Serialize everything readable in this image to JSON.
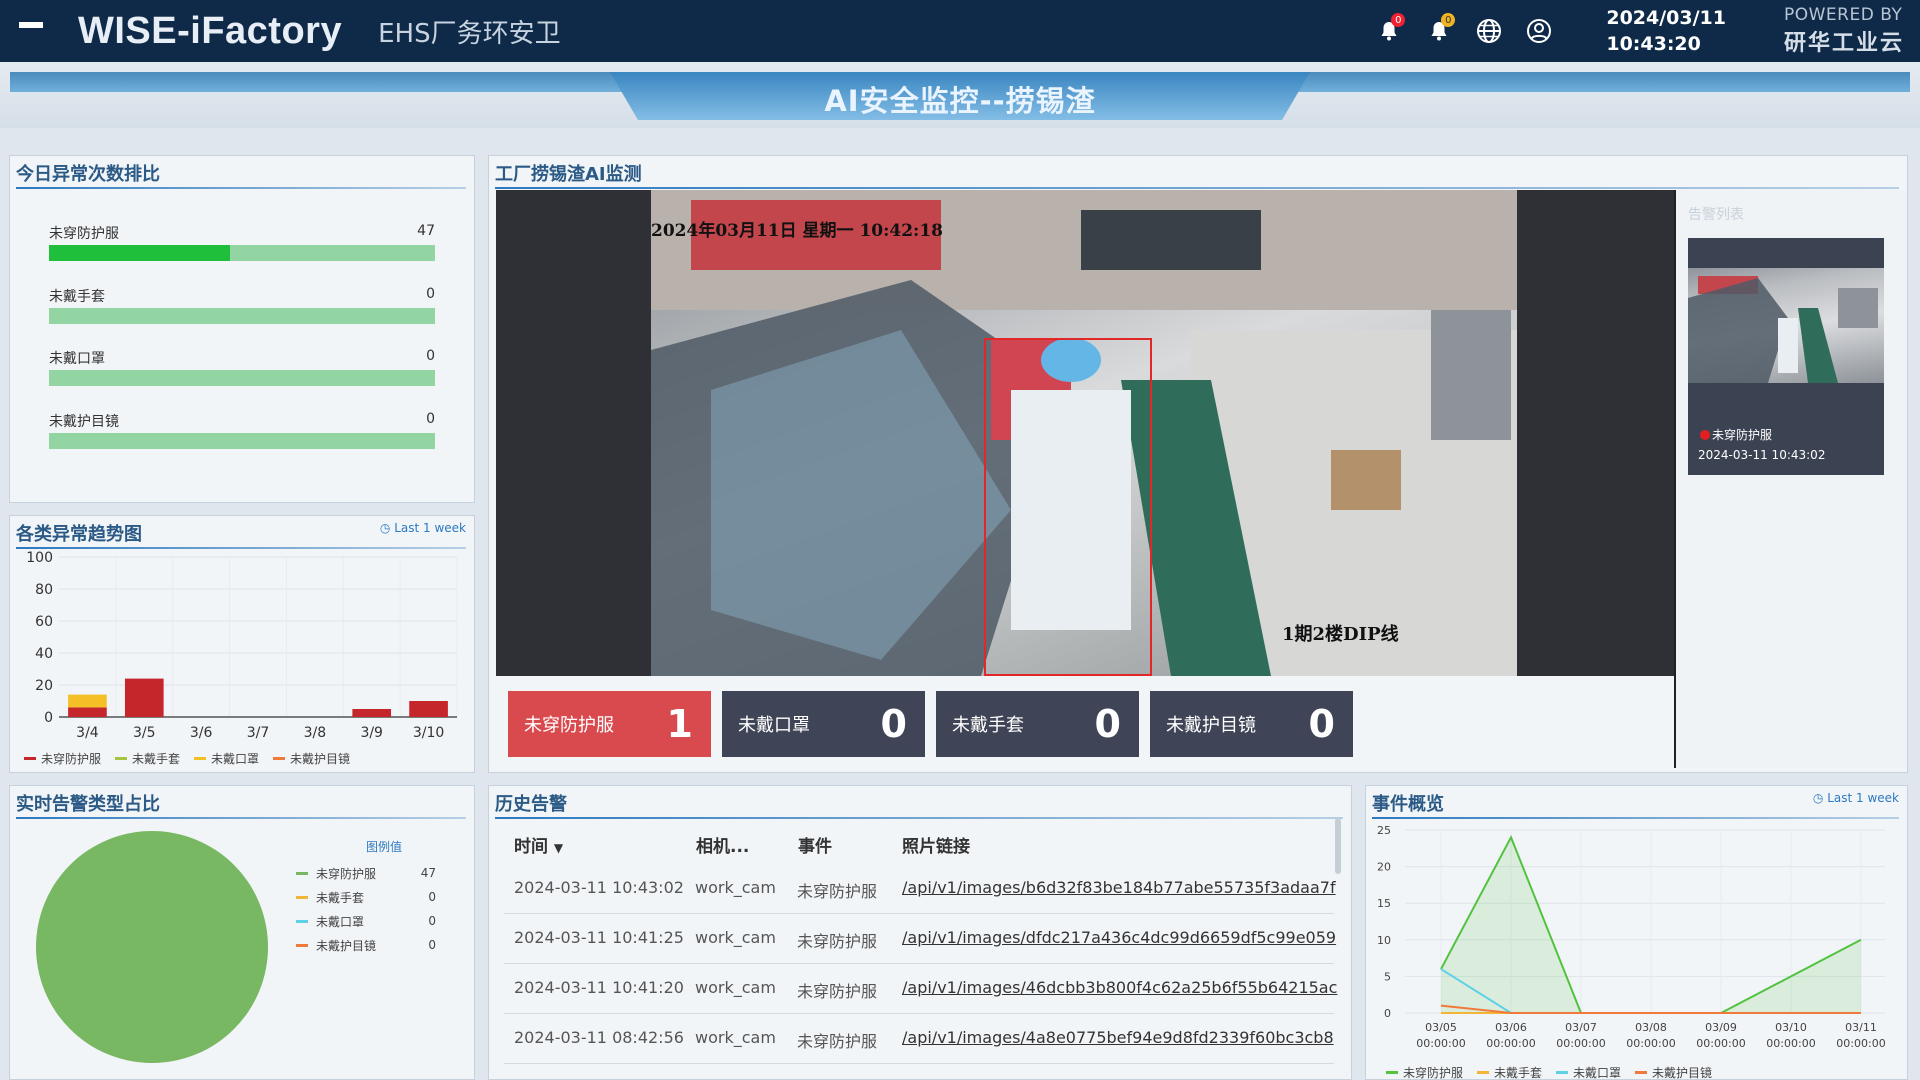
{
  "header": {
    "brand": "WISE-iFactory",
    "module": "EHS厂务环安卫",
    "notif_count_1": "0",
    "notif_count_2": "0",
    "date": "2024/03/11",
    "time": "10:43:20",
    "powered_by": "POWERED BY",
    "vendor": "研华工业云",
    "icons": [
      "menu-icon",
      "bell-icon",
      "bell-icon",
      "globe-icon",
      "user-icon"
    ]
  },
  "page_title": "AI安全监控--捞锡渣",
  "ranking": {
    "title": "今日异常次数排比",
    "max": 47,
    "items": [
      {
        "label": "未穿防护服",
        "value": 47,
        "fill": 0.47
      },
      {
        "label": "未戴手套",
        "value": 0,
        "fill": 0
      },
      {
        "label": "未戴口罩",
        "value": 0,
        "fill": 0
      },
      {
        "label": "未戴护目镜",
        "value": 0,
        "fill": 0
      }
    ]
  },
  "trend": {
    "title": "各类异常趋势图",
    "range": "Last 1 week",
    "legend": [
      "未穿防护服",
      "未戴手套",
      "未戴口罩",
      "未戴护目镜"
    ]
  },
  "monitor": {
    "title": "工厂捞锡渣AI监测",
    "timestamp": "2024年03月11日 星期一 10:42:18",
    "location": "1期2楼DIP线",
    "alert_list_title": "告警列表",
    "alert": {
      "event": "未穿防护服",
      "time": "2024-03-11 10:43:02"
    },
    "stats": [
      {
        "label": "未穿防护服",
        "value": "1",
        "color": "#d94a4f"
      },
      {
        "label": "未戴口罩",
        "value": "0",
        "color": "#3f4556"
      },
      {
        "label": "未戴手套",
        "value": "0",
        "color": "#3f4556"
      },
      {
        "label": "未戴护目镜",
        "value": "0",
        "color": "#3f4556"
      }
    ]
  },
  "pie": {
    "title": "实时告警类型占比",
    "legend_header": "图例值",
    "items": [
      {
        "label": "未穿防护服",
        "value": "47",
        "color": "#78b862"
      },
      {
        "label": "未戴手套",
        "value": "0",
        "color": "#f2b538"
      },
      {
        "label": "未戴口罩",
        "value": "0",
        "color": "#5ed1e6"
      },
      {
        "label": "未戴护目镜",
        "value": "0",
        "color": "#f07a3b"
      }
    ]
  },
  "history": {
    "title": "历史告警",
    "columns": [
      "时间",
      "相机...",
      "事件",
      "照片链接"
    ],
    "rows": [
      {
        "time": "2024-03-11 10:43:02",
        "camera": "work_cam",
        "event": "未穿防护服",
        "link": "/api/v1/images/b6d32f83be184b77abe55735f3adaa7f"
      },
      {
        "time": "2024-03-11 10:41:25",
        "camera": "work_cam",
        "event": "未穿防护服",
        "link": "/api/v1/images/dfdc217a436c4dc99d6659df5c99e059"
      },
      {
        "time": "2024-03-11 10:41:20",
        "camera": "work_cam",
        "event": "未穿防护服",
        "link": "/api/v1/images/46dcbb3b800f4c62a25b6f55b64215ac"
      },
      {
        "time": "2024-03-11 08:42:56",
        "camera": "work_cam",
        "event": "未穿防护服",
        "link": "/api/v1/images/4a8e0775bef94e9d8fd2339f60bc3cb8"
      }
    ]
  },
  "overview": {
    "title": "事件概览",
    "range": "Last 1 week",
    "legend": [
      "未穿防护服",
      "未戴手套",
      "未戴口罩",
      "未戴护目镜"
    ]
  },
  "chart_data": [
    {
      "type": "bar",
      "title": "各类异常趋势图",
      "categories": [
        "3/4",
        "3/5",
        "3/6",
        "3/7",
        "3/8",
        "3/9",
        "3/10"
      ],
      "ylim": [
        0,
        100
      ],
      "yticks": [
        0,
        20,
        40,
        60,
        80,
        100
      ],
      "stacked": true,
      "series": [
        {
          "name": "未穿防护服",
          "color": "#c5262c",
          "values": [
            6,
            24,
            0,
            0,
            0,
            5,
            10
          ]
        },
        {
          "name": "未戴手套",
          "color": "#a7c63f",
          "values": [
            0,
            0,
            0,
            0,
            0,
            0,
            0
          ]
        },
        {
          "name": "未戴口罩",
          "color": "#f4c025",
          "values": [
            8,
            0,
            0,
            0,
            0,
            0,
            0
          ]
        },
        {
          "name": "未戴护目镜",
          "color": "#f07a3b",
          "values": [
            0,
            0,
            0,
            0,
            0,
            0,
            0
          ]
        }
      ]
    },
    {
      "type": "pie",
      "title": "实时告警类型占比",
      "labels": [
        "未穿防护服",
        "未戴手套",
        "未戴口罩",
        "未戴护目镜"
      ],
      "values": [
        47,
        0,
        0,
        0
      ]
    },
    {
      "type": "area",
      "title": "事件概览",
      "x": [
        "03/05 00:00:00",
        "03/06 00:00:00",
        "03/07 00:00:00",
        "03/08 00:00:00",
        "03/09 00:00:00",
        "03/10 00:00:00",
        "03/11 00:00:00"
      ],
      "xticks": [
        [
          "03/05",
          "00:00:00"
        ],
        [
          "03/06",
          "00:00:00"
        ],
        [
          "03/07",
          "00:00:00"
        ],
        [
          "03/08",
          "00:00:00"
        ],
        [
          "03/09",
          "00:00:00"
        ],
        [
          "03/10",
          "00:00:00"
        ],
        [
          "03/11",
          "00:00:00"
        ]
      ],
      "ylim": [
        0,
        25
      ],
      "yticks": [
        0,
        5,
        10,
        15,
        20,
        25
      ],
      "series": [
        {
          "name": "未穿防护服",
          "color": "#52c23f",
          "values": [
            6,
            24,
            0,
            0,
            0,
            5,
            10
          ]
        },
        {
          "name": "未戴手套",
          "color": "#f2b538",
          "values": [
            0,
            0,
            0,
            0,
            0,
            0,
            0
          ]
        },
        {
          "name": "未戴口罩",
          "color": "#5ed1e6",
          "values": [
            6,
            0,
            0,
            0,
            0,
            0,
            0
          ]
        },
        {
          "name": "未戴护目镜",
          "color": "#f07a3b",
          "values": [
            1,
            0,
            0,
            0,
            0,
            0,
            0
          ]
        }
      ]
    }
  ]
}
